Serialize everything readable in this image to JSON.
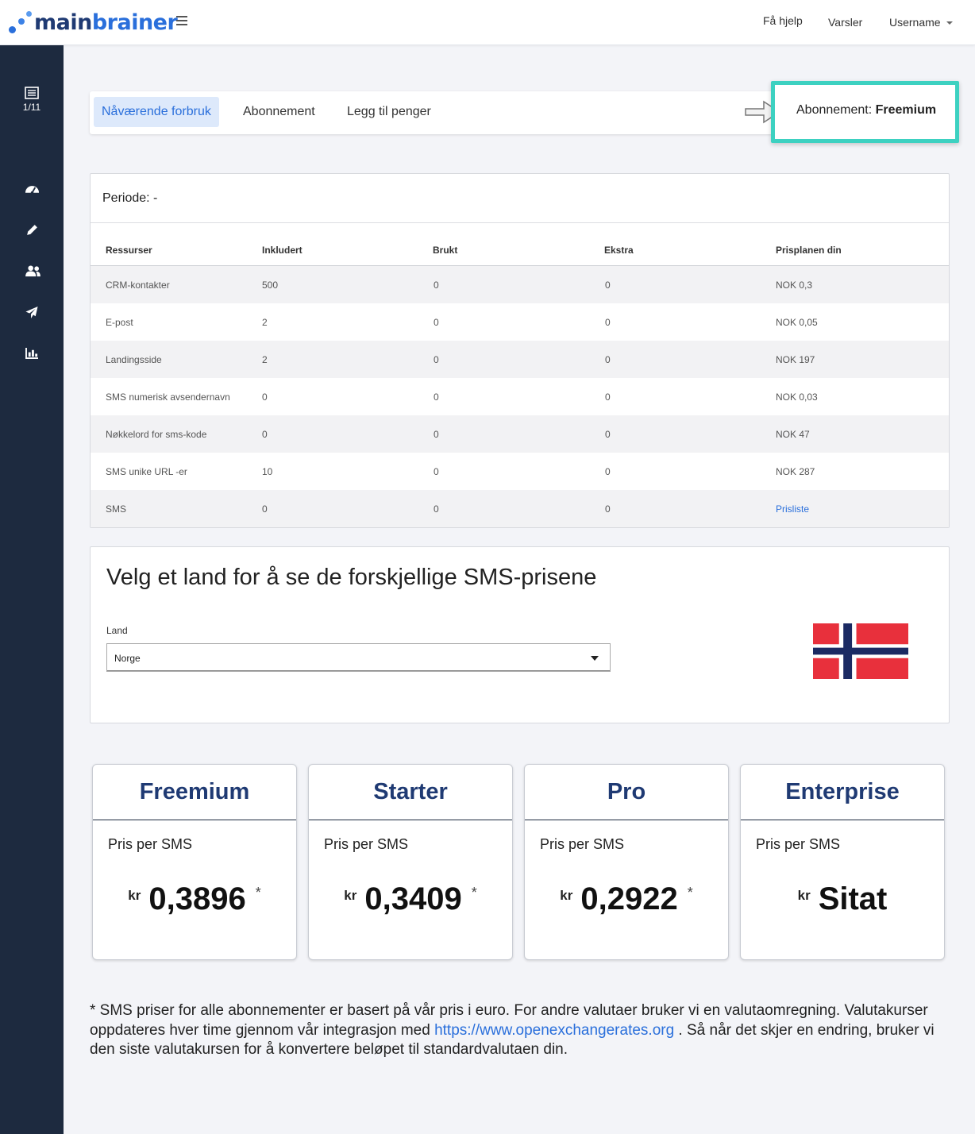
{
  "header": {
    "logo_main": "main",
    "logo_brainer": "brainer",
    "nav": [
      "Få hjelp",
      "Varsler",
      "Username"
    ]
  },
  "sidebar": {
    "counter": "1/11",
    "icons": [
      "list-icon",
      "dashboard-icon",
      "pencil-icon",
      "users-icon",
      "send-icon",
      "chart-icon"
    ]
  },
  "tabs": {
    "items": [
      "Nåværende forbruk",
      "Abonnement",
      "Legg til penger"
    ],
    "active": 0,
    "subscription_label": "Abonnement: ",
    "subscription_value": "Freemium"
  },
  "usage": {
    "period": "Periode: -",
    "columns": [
      "Ressurser",
      "Inkludert",
      "Brukt",
      "Ekstra",
      "Prisplanen din"
    ],
    "rows": [
      [
        "CRM-kontakter",
        "500",
        "0",
        "0",
        "NOK 0,3"
      ],
      [
        "E-post",
        "2",
        "0",
        "0",
        "NOK 0,05"
      ],
      [
        "Landingsside",
        "2",
        "0",
        "0",
        "NOK 197"
      ],
      [
        "SMS numerisk avsendernavn",
        "0",
        "0",
        "0",
        "NOK 0,03"
      ],
      [
        "Nøkkelord for sms-kode",
        "0",
        "0",
        "0",
        "NOK 47"
      ],
      [
        "SMS unike URL -er",
        "10",
        "0",
        "0",
        "NOK 287"
      ],
      [
        "SMS",
        "0",
        "0",
        "0",
        "Prisliste"
      ]
    ]
  },
  "country": {
    "title": "Velg et land for å se de forskjellige SMS-prisene",
    "label": "Land",
    "selected": "Norge",
    "flag_colors": {
      "red": "#e8303c",
      "white": "#ffffff",
      "blue": "#1b2a63"
    }
  },
  "plans": [
    {
      "name": "Freemium",
      "label": "Pris per SMS",
      "currency": "kr",
      "price": "0,3896",
      "star": "*"
    },
    {
      "name": "Starter",
      "label": "Pris per SMS",
      "currency": "kr",
      "price": "0,3409",
      "star": "*"
    },
    {
      "name": "Pro",
      "label": "Pris per SMS",
      "currency": "kr",
      "price": "0,2922",
      "star": "*"
    },
    {
      "name": "Enterprise",
      "label": "Pris per SMS",
      "currency": "kr",
      "price": "Sitat",
      "star": ""
    }
  ],
  "footnote": {
    "text_before": "* SMS priser for alle abonnementer er basert på vår pris i euro. For andre valutaer bruker vi en valutaomregning. Valutakurser oppdateres hver time gjennom vår integrasjon med ",
    "link": "https://www.openexchangerates.org",
    "text_after": " . Så når det skjer en endring, bruker vi den siste valutakursen for å konvertere beløpet til standardvalutaen din."
  },
  "colors": {
    "accent": "#2a6fdb",
    "sidebar_bg": "#1d2a3f",
    "highlight_border": "#3dd1c1"
  }
}
